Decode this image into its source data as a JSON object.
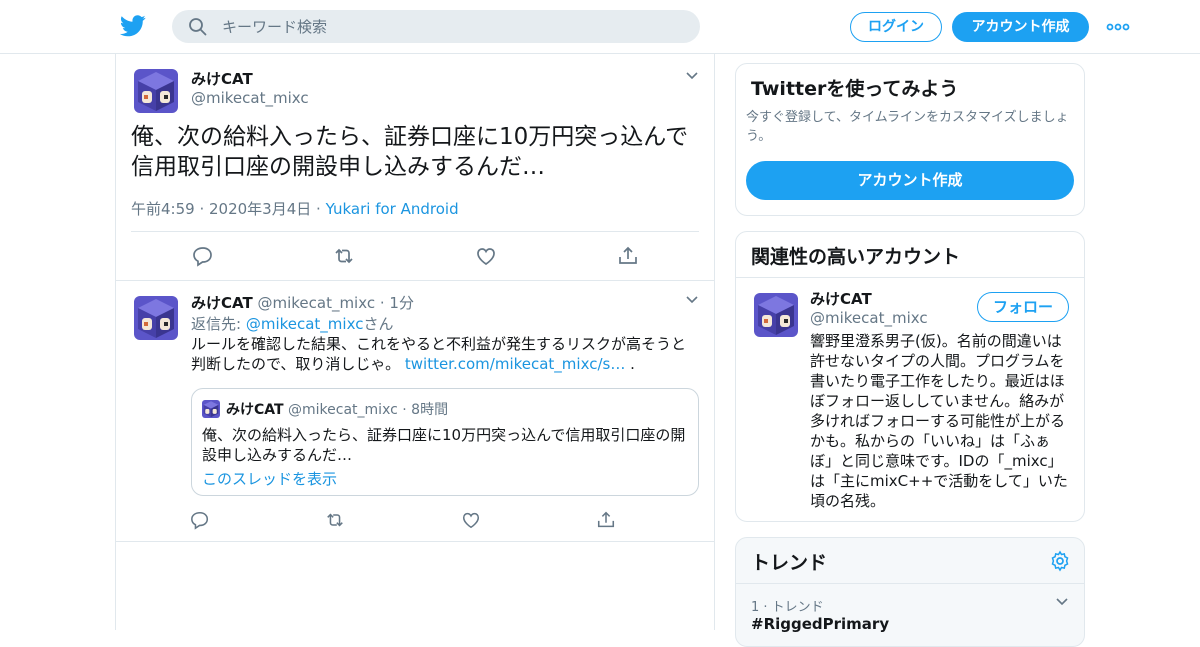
{
  "header": {
    "search_placeholder": "キーワード検索",
    "login_label": "ログイン",
    "signup_label": "アカウント作成"
  },
  "main_tweet": {
    "name": "みけCAT",
    "handle": "@mikecat_mixc",
    "text": "俺、次の給料入ったら、証券口座に10万円突っ込んで信用取引口座の開設申し込みするんだ…",
    "time": "午前4:59 · 2020年3月4日",
    "sep": " · ",
    "source": "Yukari for Android"
  },
  "reply": {
    "name": "みけCAT",
    "handle": "@mikecat_mixc",
    "time": "1分",
    "dot": " · ",
    "reply_to_prefix": "返信先: ",
    "reply_to_handle": "@mikecat_mixc",
    "reply_to_suffix": "さん",
    "text": "ルールを確認した結果、これをやると不利益が発生するリスクが高そうと判断したので、取り消しじゃ。 ",
    "link": "twitter.com/mikecat_mixc/s…",
    "tail": " .",
    "quote": {
      "name": "みけCAT",
      "handle": "@mikecat_mixc",
      "dot": " · ",
      "time": "8時間",
      "text": "俺、次の給料入ったら、証券口座に10万円突っ込んで信用取引口座の開設申し込みするんだ…",
      "thread_link": "このスレッドを表示"
    }
  },
  "signup_box": {
    "title": "Twitterを使ってみよう",
    "subtitle": "今すぐ登録して、タイムラインをカスタマイズしましょう。",
    "button": "アカウント作成"
  },
  "related": {
    "title": "関連性の高いアカウント",
    "name": "みけCAT",
    "handle": "@mikecat_mixc",
    "follow": "フォロー",
    "bio": "響野里澄系男子(仮)。名前の間違いは許せないタイプの人間。プログラムを書いたり電子工作をしたり。最近はほぼフォロー返ししていません。絡みが多ければフォローする可能性が上がるかも。私からの「いいね」は「ふぁぼ」と同じ意味です。IDの「_mixc」は「主にmixC++で活動をして」いた頃の名残。"
  },
  "trends": {
    "title": "トレンド",
    "item_rank": "1 · トレンド",
    "item_name": "#RiggedPrimary"
  },
  "colors": {
    "accent": "#1da1f2",
    "link": "#1b95e0",
    "muted": "#657786",
    "border": "#e1e8ed"
  }
}
